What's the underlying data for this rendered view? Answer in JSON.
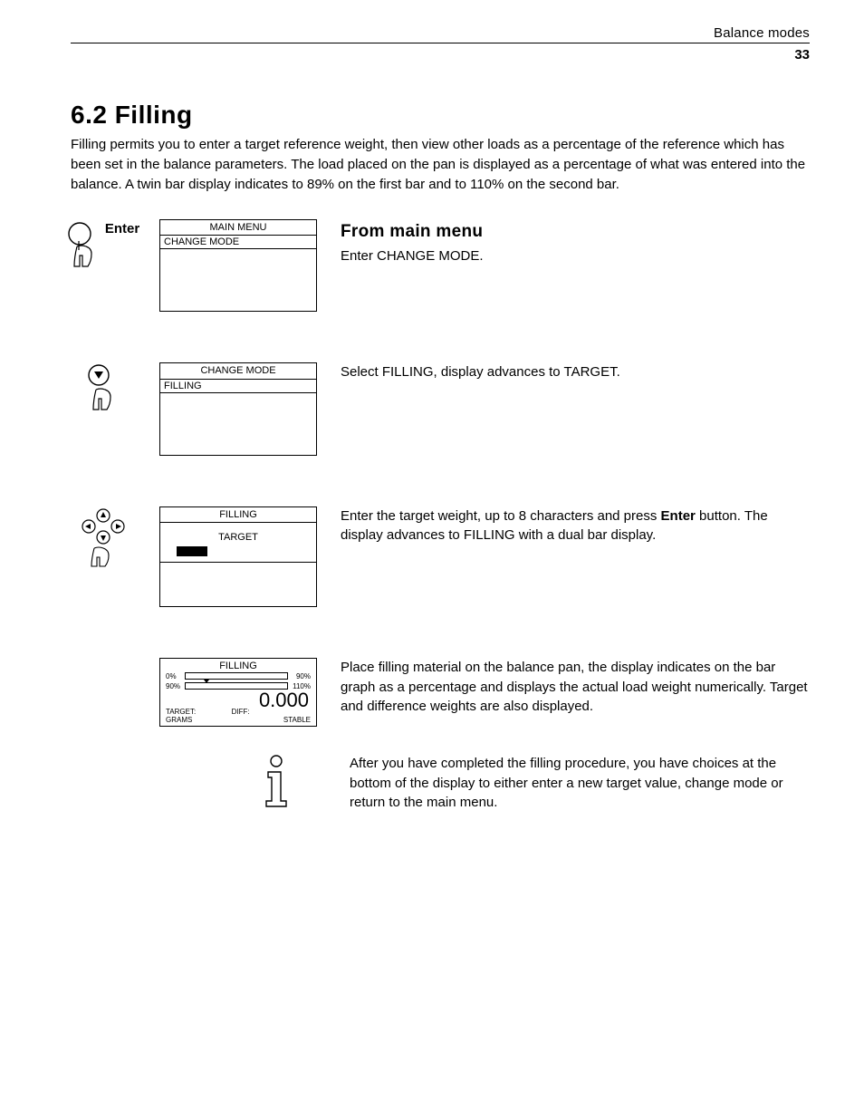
{
  "header": {
    "running": "Balance modes",
    "page_number": "33"
  },
  "section": {
    "title": "6.2 Filling",
    "intro": "Filling permits you to enter a target reference weight, then view other loads as a percentage of the reference which has been set in the balance parameters. The load placed on the pan is displayed as a percentage of what was entered into the balance. A twin bar display indicates to 89% on the first bar and to 110% on the second bar."
  },
  "steps": {
    "s1": {
      "button_label": "Enter",
      "screen_title": "MAIN MENU",
      "screen_highlight": "CHANGE MODE",
      "subheading": "From main menu",
      "desc": "Enter CHANGE MODE."
    },
    "s2": {
      "screen_title": "CHANGE MODE",
      "screen_highlight": "FILLING",
      "desc": "Select FILLING, display advances to TARGET."
    },
    "s3": {
      "screen_title": "FILLING",
      "screen_center": "TARGET",
      "desc_pre": "Enter the target weight, up to 8 characters and press ",
      "desc_bold": "Enter",
      "desc_post": " button. The display advances to FILLING with a dual bar display."
    },
    "s4": {
      "fill_title": "FILLING",
      "bar1_left": "0%",
      "bar1_right": "90%",
      "bar2_left": "90%",
      "bar2_right": "110%",
      "readout": "0.000",
      "target_label": "TARGET:",
      "diff_label": "DIFF:",
      "units": "GRAMS",
      "stable": "STABLE",
      "desc": "Place filling material on the balance pan, the display indicates on the bar graph as a percentage and displays the actual load weight numerically. Target and difference weights are also displayed."
    },
    "s5": {
      "desc": "After you have completed the filling procedure, you have choices at the bottom of the display to either enter a new target value, change mode or return to the main menu."
    }
  }
}
